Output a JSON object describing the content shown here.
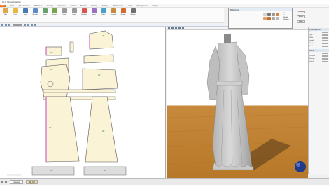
{
  "window": {
    "app_title": "CLO Virtual Fashion"
  },
  "menu": [
    "File",
    "Edit",
    "3D Garment",
    "2D Pattern",
    "Sewing",
    "Materials",
    "Avatar",
    "Render",
    "Display",
    "Settings",
    "Preferences",
    "Help",
    "Management",
    "Plugins"
  ],
  "ribbon": [
    {
      "label": "New",
      "color": "#e1a54a"
    },
    {
      "label": "Open",
      "color": "#e6b93f"
    },
    {
      "label": "Save",
      "color": "#4b78b5"
    },
    {
      "label": "Save As",
      "color": "#5c8bc7"
    },
    {
      "label": "Import",
      "color": "#6aa16a"
    },
    {
      "label": "Export",
      "color": "#76a44f"
    },
    {
      "label": "Undo",
      "color": "#999999"
    },
    {
      "label": "Redo",
      "color": "#999999"
    },
    {
      "label": "Simulate",
      "color": "#d9534f"
    },
    {
      "label": "Avatar",
      "color": "#9a72c4"
    },
    {
      "label": "Fabric",
      "color": "#4aa0c8"
    },
    {
      "label": "Snapshot",
      "color": "#c8893f"
    },
    {
      "label": "Render",
      "color": "#d46a2e"
    },
    {
      "label": "Settings",
      "color": "#707070"
    }
  ],
  "float_window": {
    "title": "3D Garment",
    "options": [
      "Fit",
      "Thickness",
      "Wrinkle",
      "Shading"
    ]
  },
  "right_mini": {
    "btn_a": "Simulate",
    "btn_b": "Avatar",
    "btn_c": "Fabric"
  },
  "props": {
    "section_a": "Property Editor",
    "section_b": "Fabric",
    "rows": [
      "Name",
      "Type",
      "Width",
      "Length",
      "Weight",
      "Shrink",
      "Layer",
      "Pressure",
      "Strength",
      "Particle"
    ]
  },
  "status": {
    "tab1": "Colorway",
    "tab2": "DE_Gift"
  },
  "colors": {
    "garment": "#c9c9c9",
    "floor": "#c7893c",
    "pattern_fill": "#fbf3d6"
  }
}
